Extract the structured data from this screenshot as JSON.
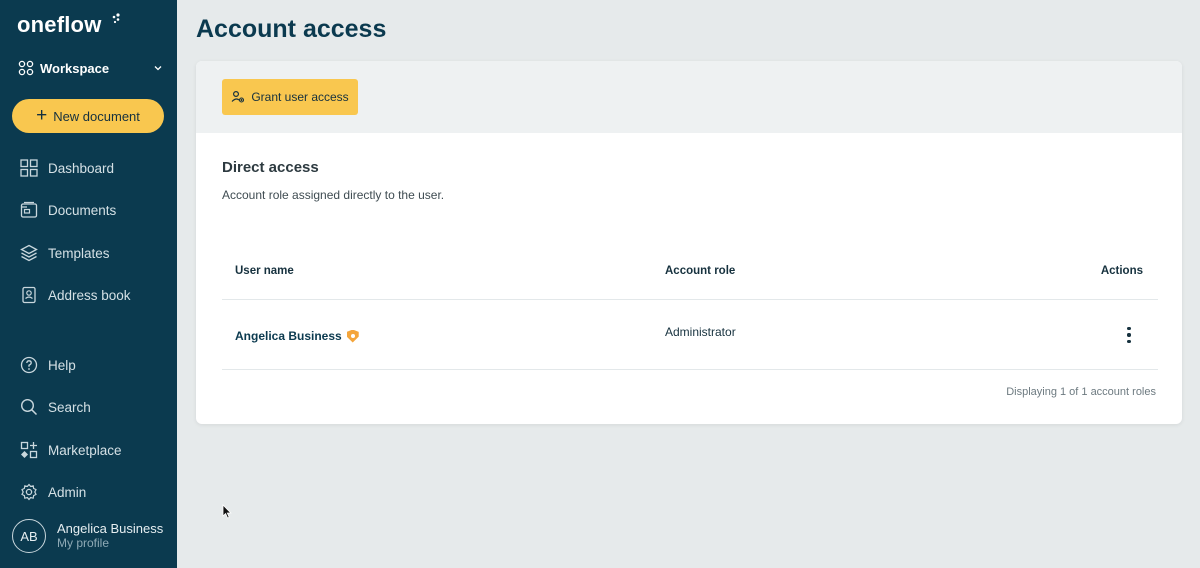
{
  "app": {
    "logo": "oneflow",
    "workspace_label": "Workspace"
  },
  "sidebar": {
    "new_document": "New document",
    "items": [
      {
        "label": "Dashboard",
        "icon": "dashboard-icon"
      },
      {
        "label": "Documents",
        "icon": "documents-icon"
      },
      {
        "label": "Templates",
        "icon": "templates-icon"
      },
      {
        "label": "Address book",
        "icon": "address-book-icon"
      },
      {
        "label": "Help",
        "icon": "help-icon"
      },
      {
        "label": "Search",
        "icon": "search-icon"
      },
      {
        "label": "Marketplace",
        "icon": "marketplace-icon"
      },
      {
        "label": "Admin",
        "icon": "gear-icon"
      }
    ],
    "profile": {
      "initials": "AB",
      "name": "Angelica Business",
      "subtitle": "My profile"
    }
  },
  "main": {
    "title": "Account access",
    "grant_button": "Grant user access",
    "section_title": "Direct access",
    "section_desc": "Account role assigned directly to the user.",
    "table": {
      "headers": [
        "User name",
        "Account role",
        "Actions"
      ],
      "rows": [
        {
          "user": "Angelica Business",
          "role": "Administrator"
        }
      ]
    },
    "footer": "Displaying 1 of 1 account roles"
  },
  "colors": {
    "sidebar_bg": "#0b3a4f",
    "accent": "#f9c74f",
    "badge": "#f4a53b"
  }
}
